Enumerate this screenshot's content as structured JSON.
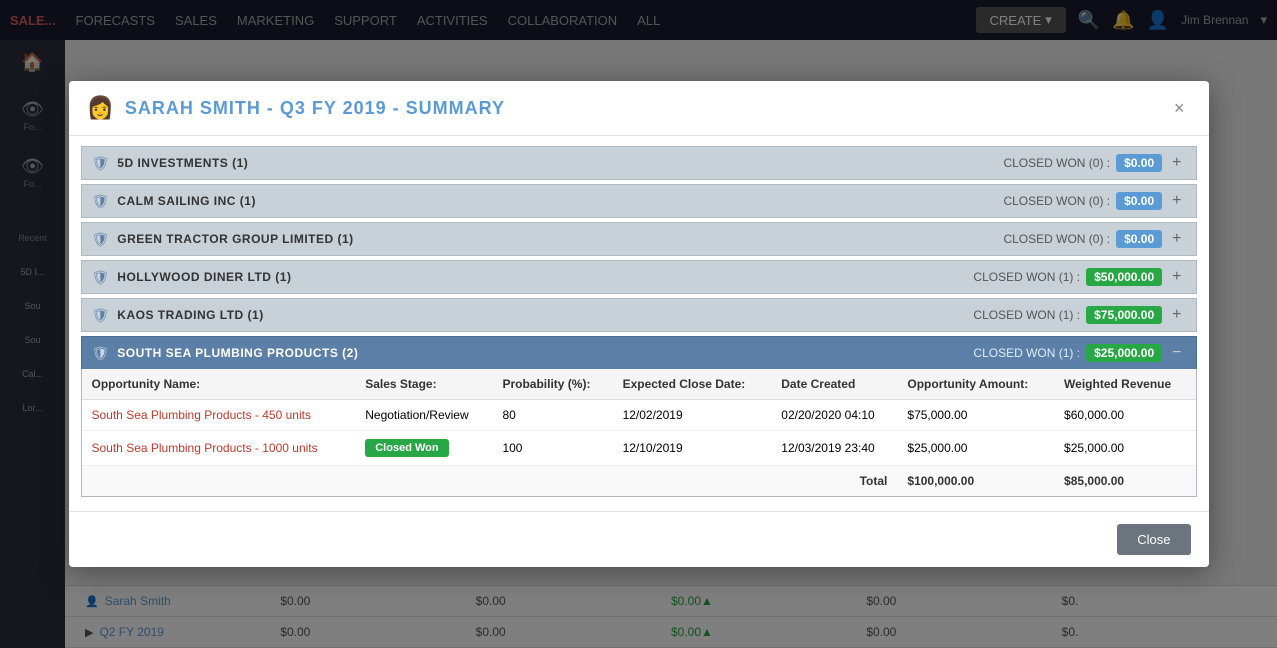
{
  "modal": {
    "title": "SARAH SMITH - Q3 FY 2019 - SUMMARY",
    "close_label": "×",
    "footer_close_label": "Close"
  },
  "accounts": [
    {
      "name": "5D INVESTMENTS (1)",
      "status": "CLOSED WON (0) :",
      "amount": "$0.00",
      "amount_type": "zero",
      "expanded": false
    },
    {
      "name": "CALM SAILING INC (1)",
      "status": "CLOSED WON (0) :",
      "amount": "$0.00",
      "amount_type": "zero",
      "expanded": false
    },
    {
      "name": "GREEN TRACTOR GROUP LIMITED (1)",
      "status": "CLOSED WON (0) :",
      "amount": "$0.00",
      "amount_type": "zero",
      "expanded": false
    },
    {
      "name": "HOLLYWOOD DINER LTD (1)",
      "status": "CLOSED WON (1) :",
      "amount": "$50,000.00",
      "amount_type": "green",
      "expanded": false
    },
    {
      "name": "KAOS TRADING LTD (1)",
      "status": "CLOSED WON (1) :",
      "amount": "$75,000.00",
      "amount_type": "green",
      "expanded": false
    },
    {
      "name": "SOUTH SEA PLUMBING PRODUCTS (2)",
      "status": "CLOSED WON (1) :",
      "amount": "$25,000.00",
      "amount_type": "green",
      "expanded": true
    }
  ],
  "opportunity_table": {
    "headers": [
      "Opportunity Name:",
      "Sales Stage:",
      "Probability (%):",
      "Expected Close Date:",
      "Date Created",
      "Opportunity Amount:",
      "Weighted Revenue"
    ],
    "rows": [
      {
        "name": "South Sea Plumbing Products - 450 units",
        "stage": "Negotiation/Review",
        "stage_badge": false,
        "probability": "80",
        "close_date": "12/02/2019",
        "date_created": "02/20/2020 04:10",
        "amount": "$75,000.00",
        "weighted": "$60,000.00"
      },
      {
        "name": "South Sea Plumbing Products - 1000 units",
        "stage": "Closed Won",
        "stage_badge": true,
        "probability": "100",
        "close_date": "12/10/2019",
        "date_created": "12/03/2019 23:40",
        "amount": "$25,000.00",
        "weighted": "$25,000.00"
      }
    ],
    "total": {
      "label": "Total",
      "amount": "$100,000.00",
      "weighted": "$85,000.00"
    }
  },
  "background": {
    "nav_items": [
      "FORECASTS",
      "SALES",
      "MARKETING",
      "SUPPORT",
      "ACTIVITIES",
      "COLLABORATION",
      "ALL"
    ],
    "create_label": "CREATE",
    "user_name": "Jim Brennan",
    "sidebar_items": [
      "👁",
      "👁",
      "🔒"
    ],
    "bg_rows": [
      {
        "label": "Sarah Smith",
        "v1": "$0.00",
        "v2": "$0.00",
        "v3": "$0.00▲",
        "v4": "$0.00",
        "v5": "$0."
      },
      {
        "label": "▶ Q2 FY 2019",
        "v1": "$0.00",
        "v2": "$0.00",
        "v3": "$0.00▲",
        "v4": "$0.00",
        "v5": "$0."
      }
    ]
  }
}
